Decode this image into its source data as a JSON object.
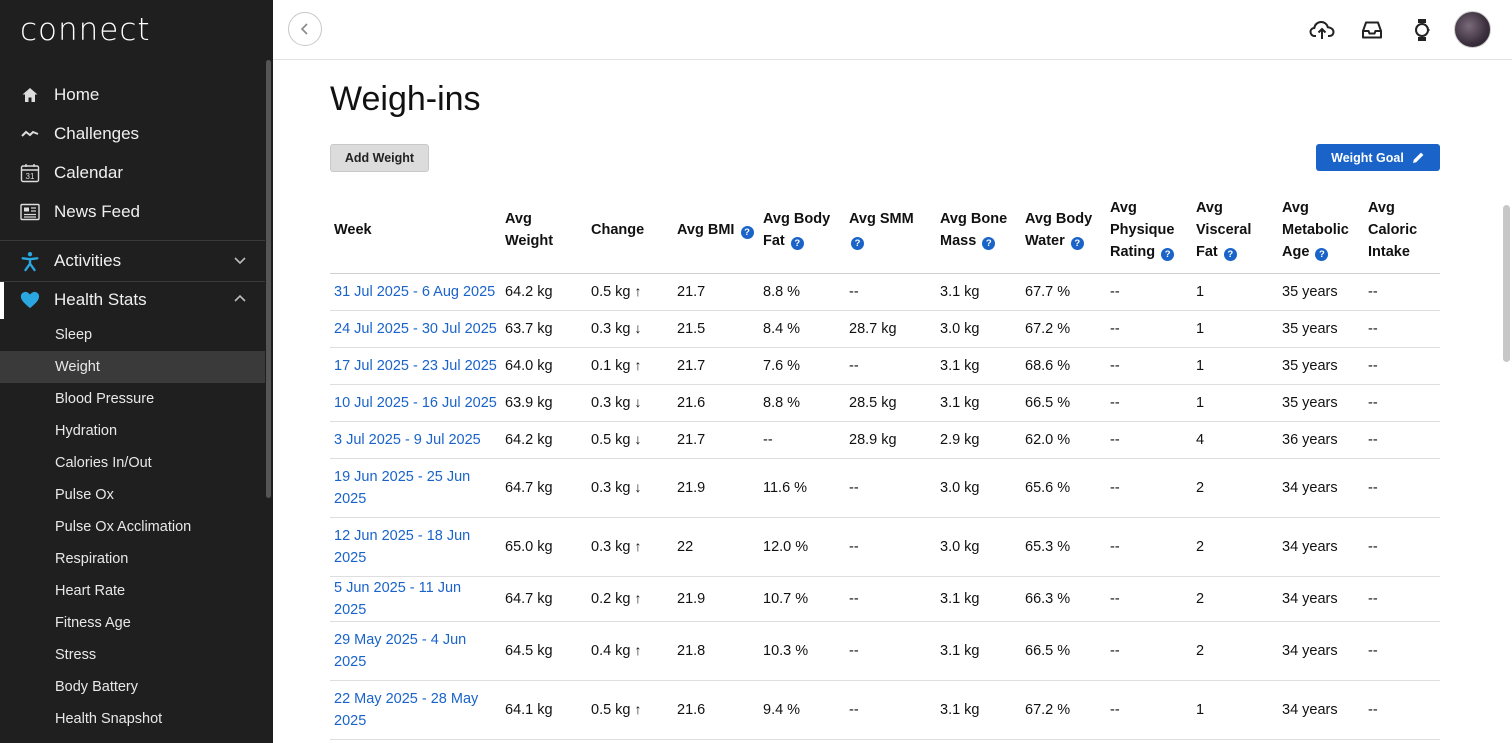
{
  "app": {
    "logo": "connect"
  },
  "sidebar": {
    "main": [
      {
        "label": "Home",
        "icon": "home-icon"
      },
      {
        "label": "Challenges",
        "icon": "challenges-icon"
      },
      {
        "label": "Calendar",
        "icon": "calendar-icon"
      },
      {
        "label": "News Feed",
        "icon": "news-feed-icon"
      }
    ],
    "sections": [
      {
        "label": "Activities",
        "icon": "activity-runner-icon",
        "expanded": false
      },
      {
        "label": "Health Stats",
        "icon": "heart-icon",
        "expanded": true
      }
    ],
    "calendar_day": "31",
    "sub_items": [
      "Sleep",
      "Weight",
      "Blood Pressure",
      "Hydration",
      "Calories In/Out",
      "Pulse Ox",
      "Pulse Ox Acclimation",
      "Respiration",
      "Heart Rate",
      "Fitness Age",
      "Stress",
      "Body Battery",
      "Health Snapshot"
    ],
    "selected": "Weight"
  },
  "topbar": {
    "icons": [
      "back-chevron-icon",
      "upload-cloud-icon",
      "inbox-icon",
      "watch-icon",
      "avatar"
    ]
  },
  "page": {
    "title": "Weigh-ins",
    "add_weight_label": "Add Weight",
    "weight_goal_label": "Weight Goal"
  },
  "colors": {
    "accent": "#1a63c9",
    "sidebar_bg": "#1f1f1f",
    "heart": "#2aa6e0"
  },
  "table": {
    "headers": [
      {
        "label": "Week",
        "help": false
      },
      {
        "label": "Avg Weight",
        "help": false
      },
      {
        "label": "Change",
        "help": false
      },
      {
        "label": "Avg BMI",
        "help": true
      },
      {
        "label": "Avg Body Fat",
        "help": true
      },
      {
        "label": "Avg SMM",
        "help": true
      },
      {
        "label": "Avg Bone Mass",
        "help": true
      },
      {
        "label": "Avg Body Water",
        "help": true
      },
      {
        "label": "Avg Physique Rating",
        "help": true
      },
      {
        "label": "Avg Visceral Fat",
        "help": true
      },
      {
        "label": "Avg Metabolic Age",
        "help": true
      },
      {
        "label": "Avg Caloric Intake",
        "help": false
      }
    ],
    "rows": [
      {
        "week": "31 Jul 2025 - 6 Aug 2025",
        "weight": "64.2 kg",
        "change": "0.5 kg",
        "dir": "up",
        "bmi": "21.7",
        "fat": "8.8 %",
        "smm": "--",
        "bone": "3.1 kg",
        "water": "67.7 %",
        "physique": "--",
        "visceral": "1",
        "age": "35 years",
        "cal": "--"
      },
      {
        "week": "24 Jul 2025 - 30 Jul 2025",
        "weight": "63.7 kg",
        "change": "0.3 kg",
        "dir": "down",
        "bmi": "21.5",
        "fat": "8.4 %",
        "smm": "28.7 kg",
        "bone": "3.0 kg",
        "water": "67.2 %",
        "physique": "--",
        "visceral": "1",
        "age": "35 years",
        "cal": "--"
      },
      {
        "week": "17 Jul 2025 - 23 Jul 2025",
        "weight": "64.0 kg",
        "change": "0.1 kg",
        "dir": "up",
        "bmi": "21.7",
        "fat": "7.6 %",
        "smm": "--",
        "bone": "3.1 kg",
        "water": "68.6 %",
        "physique": "--",
        "visceral": "1",
        "age": "35 years",
        "cal": "--"
      },
      {
        "week": "10 Jul 2025 - 16 Jul 2025",
        "weight": "63.9 kg",
        "change": "0.3 kg",
        "dir": "down",
        "bmi": "21.6",
        "fat": "8.8 %",
        "smm": "28.5 kg",
        "bone": "3.1 kg",
        "water": "66.5 %",
        "physique": "--",
        "visceral": "1",
        "age": "35 years",
        "cal": "--"
      },
      {
        "week": "3 Jul 2025 - 9 Jul 2025",
        "weight": "64.2 kg",
        "change": "0.5 kg",
        "dir": "down",
        "bmi": "21.7",
        "fat": "--",
        "smm": "28.9 kg",
        "bone": "2.9 kg",
        "water": "62.0 %",
        "physique": "--",
        "visceral": "4",
        "age": "36 years",
        "cal": "--"
      },
      {
        "week": "19 Jun 2025 - 25 Jun 2025",
        "weight": "64.7 kg",
        "change": "0.3 kg",
        "dir": "down",
        "bmi": "21.9",
        "fat": "11.6 %",
        "smm": "--",
        "bone": "3.0 kg",
        "water": "65.6 %",
        "physique": "--",
        "visceral": "2",
        "age": "34 years",
        "cal": "--"
      },
      {
        "week": "12 Jun 2025 - 18 Jun 2025",
        "weight": "65.0 kg",
        "change": "0.3 kg",
        "dir": "up",
        "bmi": "22",
        "fat": "12.0 %",
        "smm": "--",
        "bone": "3.0 kg",
        "water": "65.3 %",
        "physique": "--",
        "visceral": "2",
        "age": "34 years",
        "cal": "--"
      },
      {
        "week": "5 Jun 2025 - 11 Jun 2025",
        "weight": "64.7 kg",
        "change": "0.2 kg",
        "dir": "up",
        "bmi": "21.9",
        "fat": "10.7 %",
        "smm": "--",
        "bone": "3.1 kg",
        "water": "66.3 %",
        "physique": "--",
        "visceral": "2",
        "age": "34 years",
        "cal": "--"
      },
      {
        "week": "29 May 2025 - 4 Jun 2025",
        "weight": "64.5 kg",
        "change": "0.4 kg",
        "dir": "up",
        "bmi": "21.8",
        "fat": "10.3 %",
        "smm": "--",
        "bone": "3.1 kg",
        "water": "66.5 %",
        "physique": "--",
        "visceral": "2",
        "age": "34 years",
        "cal": "--"
      },
      {
        "week": "22 May 2025 - 28 May 2025",
        "weight": "64.1 kg",
        "change": "0.5 kg",
        "dir": "up",
        "bmi": "21.6",
        "fat": "9.4 %",
        "smm": "--",
        "bone": "3.1 kg",
        "water": "67.2 %",
        "physique": "--",
        "visceral": "1",
        "age": "34 years",
        "cal": "--"
      }
    ]
  }
}
